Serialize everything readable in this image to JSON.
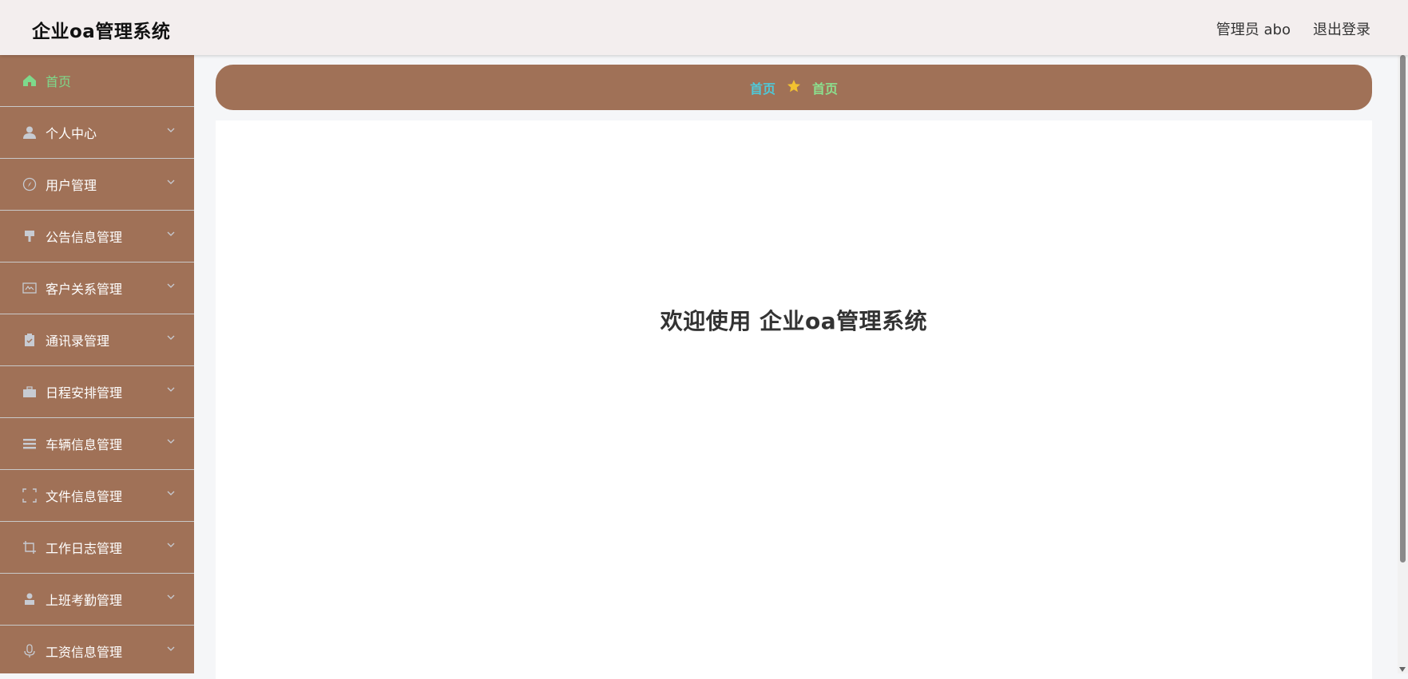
{
  "header": {
    "title": "企业oa管理系统",
    "user_label": "管理员 abo",
    "logout_label": "退出登录"
  },
  "sidebar": {
    "items": [
      {
        "label": "首页",
        "icon": "home-icon"
      },
      {
        "label": "个人中心",
        "icon": "user-icon"
      },
      {
        "label": "用户管理",
        "icon": "compass-icon"
      },
      {
        "label": "公告信息管理",
        "icon": "brush-icon"
      },
      {
        "label": "客户关系管理",
        "icon": "id-card-icon"
      },
      {
        "label": "通讯录管理",
        "icon": "clipboard-icon"
      },
      {
        "label": "日程安排管理",
        "icon": "briefcase-icon"
      },
      {
        "label": "车辆信息管理",
        "icon": "list-icon"
      },
      {
        "label": "文件信息管理",
        "icon": "frame-icon"
      },
      {
        "label": "工作日志管理",
        "icon": "crop-icon"
      },
      {
        "label": "上班考勤管理",
        "icon": "person-icon"
      },
      {
        "label": "工资信息管理",
        "icon": "microphone-icon"
      }
    ]
  },
  "breadcrumb": {
    "home": "首页",
    "separator_icon": "star-icon",
    "current": "首页"
  },
  "main": {
    "welcome": "欢迎使用 企业oa管理系统"
  },
  "colors": {
    "sidebar_bg": "#a07157",
    "active_text": "#7ed98b",
    "breadcrumb_home": "#4ec9d9",
    "star": "#f2c230"
  }
}
